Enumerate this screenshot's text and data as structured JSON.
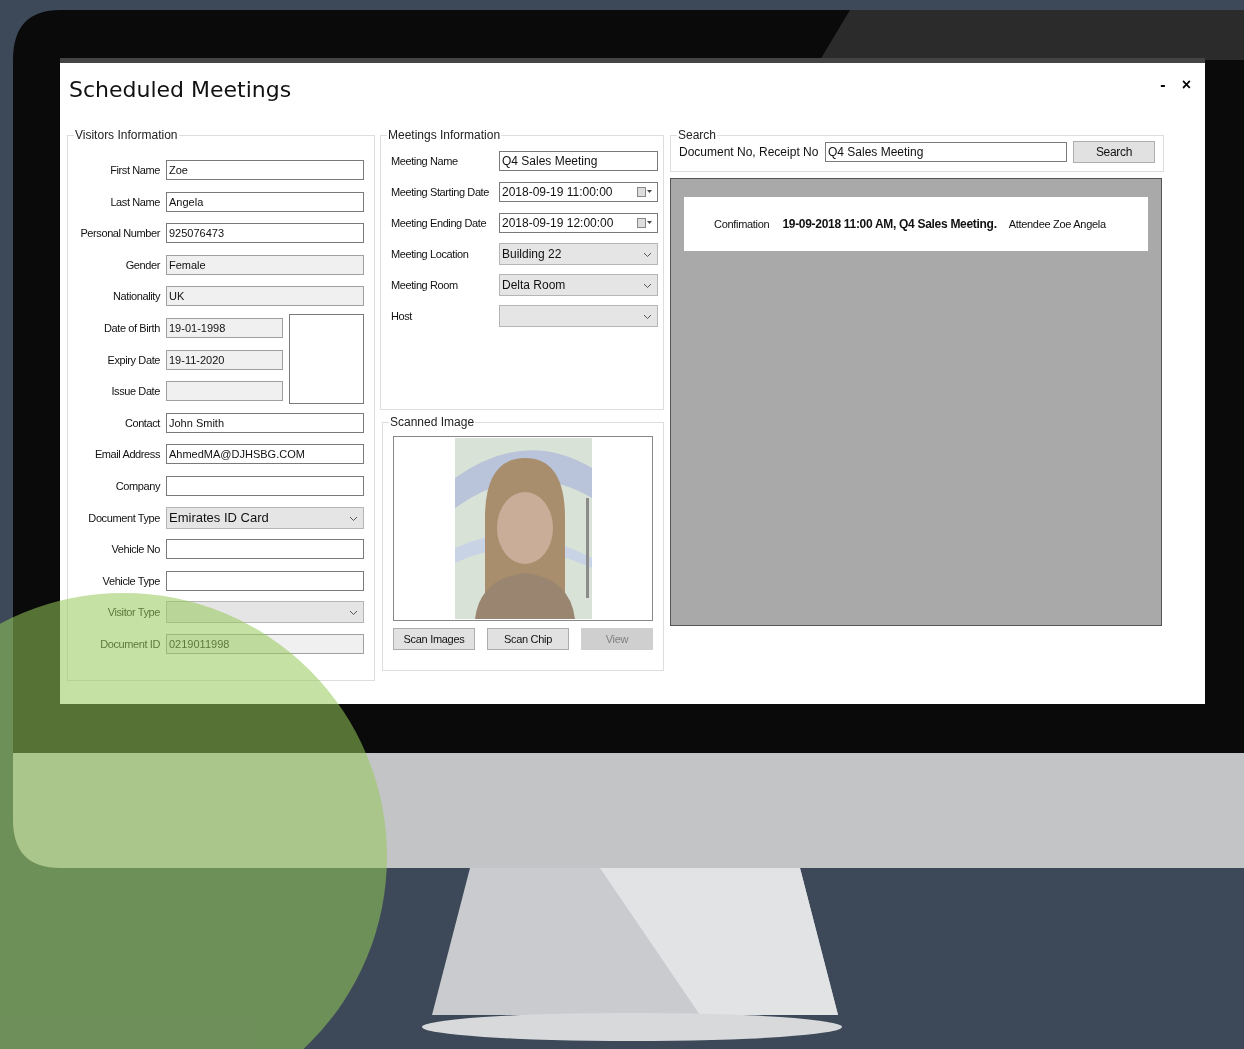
{
  "window": {
    "title": "Scheduled Meetings",
    "controls": [
      "-",
      "×"
    ]
  },
  "visitors": {
    "title": "Visitors Information",
    "fields": [
      {
        "label": "First Name",
        "value": "Zoe",
        "kind": "text",
        "disabled": false
      },
      {
        "label": "Last Name",
        "value": "Angela",
        "kind": "text",
        "disabled": false
      },
      {
        "label": "Personal Number",
        "value": "925076473",
        "kind": "text",
        "disabled": false
      },
      {
        "label": "Gender",
        "value": "Female",
        "kind": "text",
        "disabled": true
      },
      {
        "label": "Nationality",
        "value": "UK",
        "kind": "text",
        "disabled": true
      },
      {
        "label": "Date of Birth",
        "value": "19-01-1998",
        "kind": "date",
        "disabled": true
      },
      {
        "label": "Expiry Date",
        "value": "19-11-2020",
        "kind": "date",
        "disabled": true
      },
      {
        "label": "Issue Date",
        "kind": "date",
        "disabled": true
      },
      {
        "label": "Contact",
        "value": "John Smith",
        "kind": "text",
        "disabled": false
      },
      {
        "label": "Email Address",
        "value": "AhmedMA@DJHSBG.COM",
        "kind": "text",
        "disabled": false
      },
      {
        "label": "Company",
        "kind": "text",
        "disabled": false
      },
      {
        "label": "Document Type",
        "value": "Emirates ID Card",
        "kind": "combo"
      },
      {
        "label": "Vehicle No",
        "kind": "text",
        "disabled": false
      },
      {
        "label": "Vehicle Type",
        "kind": "text",
        "disabled": false
      },
      {
        "label": "Visitor Type",
        "kind": "combo"
      },
      {
        "label": "Document ID",
        "value": "0219011998",
        "kind": "text",
        "disabled": true
      }
    ]
  },
  "meetings": {
    "title": "Meetings Information",
    "fields": [
      {
        "label": "Meeting Name",
        "value": "Q4 Sales Meeting",
        "kind": "text"
      },
      {
        "label": "Meeting Starting Date",
        "value": "2018-09-19 11:00:00",
        "kind": "datetime"
      },
      {
        "label": "Meeting Ending Date",
        "value": "2018-09-19 12:00:00",
        "kind": "datetime"
      },
      {
        "label": "Meeting Location",
        "value": "Building 22",
        "kind": "combo"
      },
      {
        "label": "Meeting Room",
        "value": "Delta Room",
        "kind": "combo"
      },
      {
        "label": "Host",
        "kind": "combo"
      }
    ]
  },
  "scanned_image": {
    "title": "Scanned Image",
    "buttons": [
      {
        "label": "Scan Images",
        "disabled": false
      },
      {
        "label": "Scan Chip",
        "disabled": false
      },
      {
        "label": "View",
        "disabled": true
      }
    ]
  },
  "search": {
    "title": "Search",
    "label": "Document No, Receipt No",
    "value": "Q4 Sales Meeting",
    "button": "Search"
  },
  "results": [
    {
      "label": "Confimation",
      "details": "19-09-2018 11:00 AM, Q4 Sales Meeting.",
      "attendee": "Attendee Zoe Angela"
    }
  ]
}
